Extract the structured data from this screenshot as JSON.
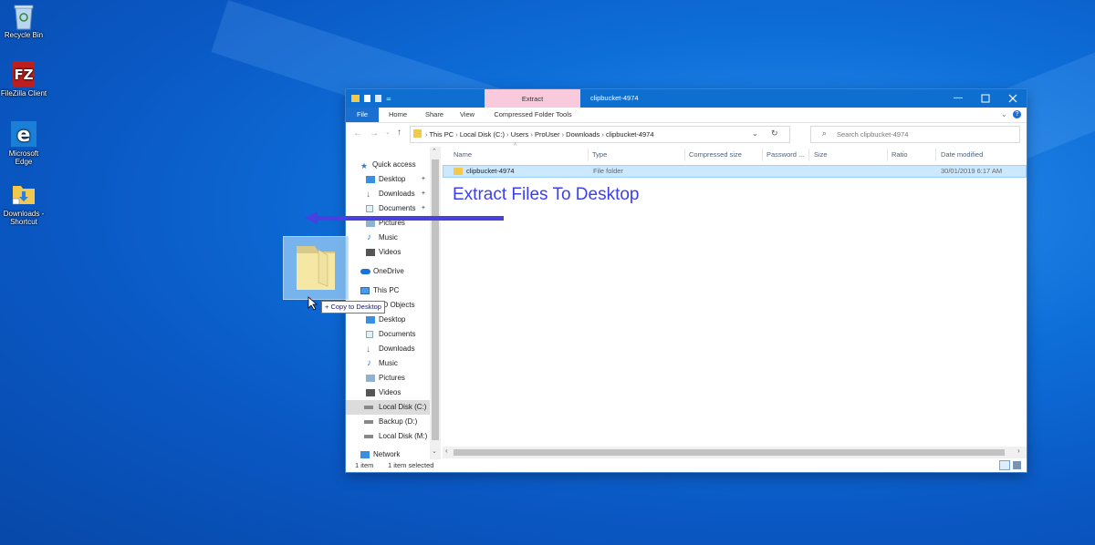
{
  "desktop": {
    "icons": [
      {
        "label": "Recycle Bin",
        "icon": "recycle-bin-icon"
      },
      {
        "label": "FileZilla Client",
        "icon": "filezilla-icon"
      },
      {
        "label": "Microsoft Edge",
        "icon": "edge-icon"
      },
      {
        "label": "Downloads - Shortcut",
        "icon": "folder-shortcut-icon"
      }
    ]
  },
  "explorer": {
    "title": "clipbucket-4974",
    "contextual_tab": "Extract",
    "ribbon_tabs": [
      "File",
      "Home",
      "Share",
      "View",
      "Compressed Folder Tools"
    ],
    "breadcrumb": [
      "This PC",
      "Local Disk (C:)",
      "Users",
      "ProUser",
      "Downloads",
      "clipbucket-4974"
    ],
    "search_placeholder": "Search clipbucket-4974",
    "nav": {
      "quick_access": "Quick access",
      "quick_items": [
        "Desktop",
        "Downloads",
        "Documents",
        "Pictures",
        "Music",
        "Videos"
      ],
      "onedrive": "OneDrive",
      "this_pc": "This PC",
      "pc_items": [
        "3D Objects",
        "Desktop",
        "Documents",
        "Downloads",
        "Music",
        "Pictures",
        "Videos",
        "Local Disk (C:)",
        "Backup (D:)",
        "Local Disk (M:)"
      ],
      "network": "Network"
    },
    "columns": [
      "Name",
      "Type",
      "Compressed size",
      "Password ...",
      "Size",
      "Ratio",
      "Date modified"
    ],
    "rows": [
      {
        "name": "clipbucket-4974",
        "type": "File folder",
        "date": "30/01/2019 6:17 AM"
      }
    ],
    "status": {
      "count": "1 item",
      "selected": "1 item selected"
    }
  },
  "overlay": {
    "annotation": "Extract Files To Desktop",
    "drag_tooltip": "+ Copy to Desktop"
  },
  "colors": {
    "accent": "#0f6fd0",
    "selection": "#cce8ff",
    "annotation": "#3c3ff0"
  }
}
